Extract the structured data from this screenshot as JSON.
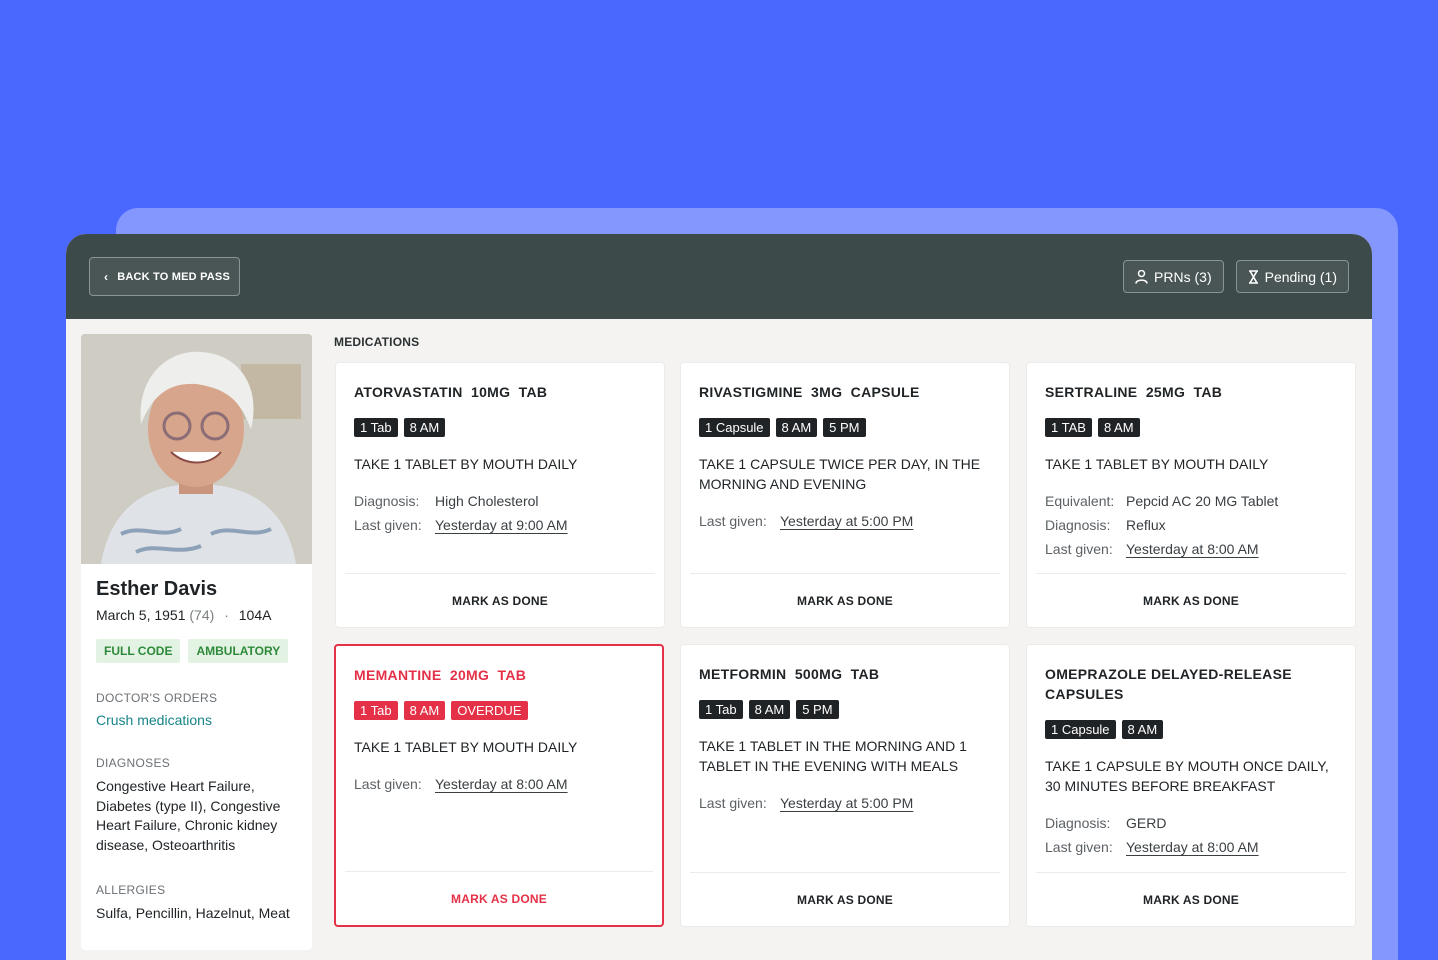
{
  "toolbar": {
    "back_label": "BACK TO MED PASS",
    "prns_label": "PRNs (3)",
    "pending_label": "Pending (1)"
  },
  "patient": {
    "name": "Esther Davis",
    "dob": "March 5, 1951",
    "age": "(74)",
    "room": "104A",
    "tags": [
      "FULL CODE",
      "AMBULATORY"
    ],
    "doctors_orders_label": "DOCTOR'S ORDERS",
    "doctors_orders": "Crush medications",
    "diagnoses_label": "DIAGNOSES",
    "diagnoses": "Congestive Heart Failure, Diabetes (type II), Congestive Heart Failure, Chronic kidney disease, Osteoarthritis",
    "allergies_label": "ALLERGIES",
    "allergies": "Sulfa, Pencillin, Hazelnut, Meat"
  },
  "medications_label": "MEDICATIONS",
  "mark_done_label": "MARK AS DONE",
  "labels": {
    "diagnosis": "Diagnosis:",
    "last_given": "Last given:",
    "equivalent": "Equivalent:"
  },
  "cards": [
    {
      "title": "ATORVASTATIN  10MG  TAB",
      "chips": [
        "1 Tab",
        "8 AM"
      ],
      "instructions": "TAKE 1 TABLET BY MOUTH DAILY",
      "diagnosis": "High Cholesterol",
      "last_given": "Yesterday at 9:00 AM"
    },
    {
      "title": "RIVASTIGMINE  3MG  CAPSULE",
      "chips": [
        "1 Capsule",
        "8 AM",
        "5 PM"
      ],
      "instructions": "TAKE 1 CAPSULE TWICE PER DAY, IN THE MORNING AND EVENING",
      "last_given": "Yesterday at 5:00 PM"
    },
    {
      "title": "SERTRALINE  25MG  TAB",
      "chips": [
        "1 TAB",
        "8 AM"
      ],
      "instructions": "TAKE 1 TABLET BY MOUTH DAILY",
      "equivalent": "Pepcid AC 20 MG Tablet",
      "diagnosis": "Reflux",
      "last_given": "Yesterday at 8:00 AM"
    },
    {
      "title": "MEMANTINE  20MG  TAB",
      "chips": [
        "1 Tab",
        "8 AM",
        "OVERDUE"
      ],
      "instructions": "TAKE 1 TABLET BY MOUTH DAILY",
      "last_given": "Yesterday at 8:00 AM",
      "status_color": "#e43147"
    },
    {
      "title": "METFORMIN  500MG  TAB",
      "chips": [
        "1 Tab",
        "8 AM",
        "5 PM"
      ],
      "instructions": "TAKE 1 TABLET IN THE MORNING AND 1 TABLET IN THE EVENING WITH MEALS",
      "last_given": "Yesterday at 5:00 PM"
    },
    {
      "title": "OMEPRAZOLE DELAYED-RELEASE CAPSULES",
      "chips": [
        "1 Capsule",
        "8 AM"
      ],
      "instructions": "TAKE 1 CAPSULE BY MOUTH ONCE DAILY, 30 MINUTES BEFORE BREAKFAST",
      "diagnosis": "GERD",
      "last_given": "Yesterday at 8:00 AM"
    }
  ],
  "colors": {
    "background": "#4a68fe",
    "topbar": "#3d4a4a",
    "overdue": "#e43147",
    "tag_green": "#2e8a3a",
    "link_teal": "#16838a"
  }
}
